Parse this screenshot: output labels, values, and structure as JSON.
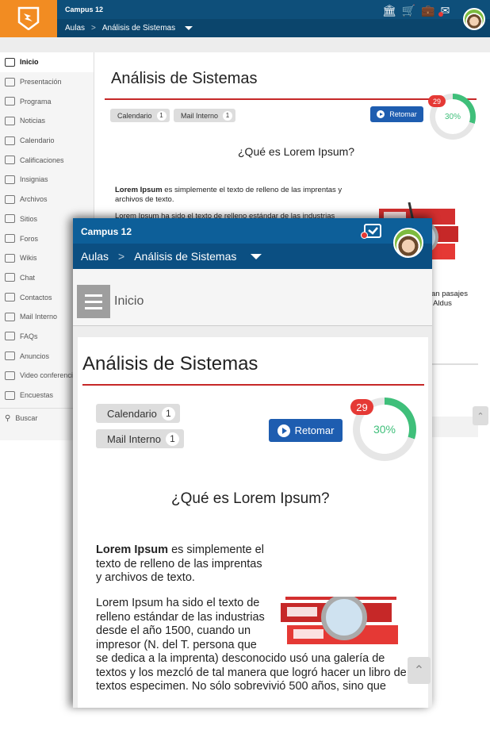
{
  "desktop": {
    "site_name": "Campus 12",
    "breadcrumb": {
      "home": "Aulas",
      "sep": ">",
      "current": "Análisis de Sistemas"
    },
    "header_icons": [
      "institution-icon",
      "cart-icon",
      "briefcase-icon",
      "mail-icon"
    ],
    "sidebar": [
      {
        "label": "Inicio",
        "icon": "home-icon",
        "active": true
      },
      {
        "label": "Presentación",
        "icon": "monitor-icon"
      },
      {
        "label": "Programa",
        "icon": "graduation-cap-icon"
      },
      {
        "label": "Noticias",
        "icon": "newspaper-icon"
      },
      {
        "label": "Calendario",
        "icon": "calendar-icon"
      },
      {
        "label": "Calificaciones",
        "icon": "check-circle-icon"
      },
      {
        "label": "Insignias",
        "icon": "trophy-icon"
      },
      {
        "label": "Archivos",
        "icon": "cloud-icon"
      },
      {
        "label": "Sitios",
        "icon": "link-icon"
      },
      {
        "label": "Foros",
        "icon": "chat-bubbles-icon"
      },
      {
        "label": "Wikis",
        "icon": "wiki-icon"
      },
      {
        "label": "Chat",
        "icon": "chat-icon"
      },
      {
        "label": "Contactos",
        "icon": "contacts-icon"
      },
      {
        "label": "Mail Interno",
        "icon": "mail-icon"
      },
      {
        "label": "FAQs",
        "icon": "info-icon"
      },
      {
        "label": "Anuncios",
        "icon": "announcement-icon"
      },
      {
        "label": "Video conferencia",
        "icon": "video-icon"
      },
      {
        "label": "Encuestas",
        "icon": "survey-icon"
      }
    ],
    "search_label": "Buscar",
    "course_title": "Análisis de Sistemas",
    "chips": [
      {
        "label": "Calendario",
        "count": "1"
      },
      {
        "label": "Mail Interno",
        "count": "1"
      }
    ],
    "resume_button": "Retomar",
    "badge": "29",
    "progress_text": "30%",
    "progress_value": 0.3,
    "question": "¿Qué es Lorem Ipsum?",
    "para1_bold": "Lorem Ipsum",
    "para1_rest": " es simplemente el texto de relleno de las imprentas y archivos de texto.",
    "para2_partial": "Lorem Ipsum ha sido el texto de relleno estándar de las industrias",
    "side_text": "an pasajes\n Aldus"
  },
  "mobile": {
    "site_name": "Campus 12",
    "breadcrumb": {
      "home": "Aulas",
      "sep": ">",
      "current": "Análisis de Sistemas"
    },
    "menu_label": "Inicio",
    "course_title": "Análisis de Sistemas",
    "chips": [
      {
        "label": "Calendario",
        "count": "1"
      },
      {
        "label": "Mail Interno",
        "count": "1"
      }
    ],
    "resume_button": "Retomar",
    "badge": "29",
    "progress_text": "30%",
    "progress_value": 0.3,
    "question": "¿Qué es Lorem Ipsum?",
    "para1_bold": "Lorem Ipsum",
    "para1_rest": " es simplemente el texto de relleno de las imprentas y archivos de texto.",
    "para2": "Lorem Ipsum ha sido el texto de relleno estándar de las industrias desde el año 1500, cuando un impresor (N. del T. persona que se dedica a la imprenta) desconocido usó una galería de textos y los mezcló de tal manera que logró hacer un libro de textos especimen. No sólo sobrevivió 500 años, sino que"
  },
  "colors": {
    "header": "#0e4f7a",
    "logo": "#f28c22",
    "accent_red": "#c62828",
    "button_blue": "#1e5db0",
    "progress_green": "#3fbf7a",
    "badge_red": "#e53935"
  }
}
